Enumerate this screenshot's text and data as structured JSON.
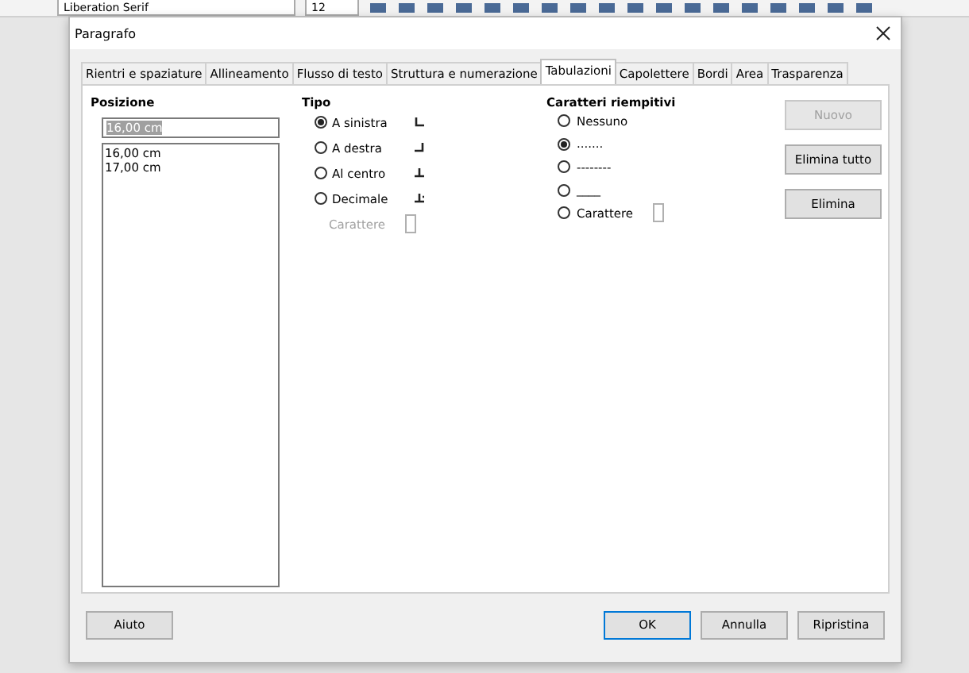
{
  "toolbar": {
    "font_name": "Liberation Serif",
    "font_size": "12"
  },
  "window": {
    "title": "Paragrafo"
  },
  "tabs": [
    {
      "label": "Rientri e spaziature",
      "selected": false
    },
    {
      "label": "Allineamento",
      "selected": false
    },
    {
      "label": "Flusso di testo",
      "selected": false
    },
    {
      "label": "Struttura e numerazione",
      "selected": false
    },
    {
      "label": "Tabulazioni",
      "selected": true
    },
    {
      "label": "Capolettere",
      "selected": false
    },
    {
      "label": "Bordi",
      "selected": false
    },
    {
      "label": "Area",
      "selected": false
    },
    {
      "label": "Trasparenza",
      "selected": false
    }
  ],
  "position": {
    "heading": "Posizione",
    "value": "16,00 cm",
    "items": [
      "16,00 cm",
      "17,00 cm"
    ]
  },
  "type": {
    "heading": "Tipo",
    "options": [
      {
        "label": "A sinistra",
        "kind": "left",
        "selected": true
      },
      {
        "label": "A destra",
        "kind": "right",
        "selected": false
      },
      {
        "label": "Al centro",
        "kind": "center",
        "selected": false
      },
      {
        "label": "Decimale",
        "kind": "decimal",
        "selected": false
      }
    ],
    "character_label": "Carattere",
    "character_disabled": true
  },
  "fill": {
    "heading": "Caratteri riempitivi",
    "options": [
      {
        "label": "Nessuno",
        "selected": false
      },
      {
        "label": ".......",
        "selected": true
      },
      {
        "label": "--------",
        "selected": false
      },
      {
        "label": "____",
        "selected": false
      },
      {
        "label": "Carattere",
        "selected": false
      }
    ]
  },
  "side_buttons": [
    {
      "label": "Nuovo",
      "disabled": true
    },
    {
      "label": "Elimina tutto",
      "disabled": false
    },
    {
      "label": "Elimina",
      "disabled": false
    }
  ],
  "help_button": "Aiuto",
  "buttons": [
    {
      "label": "OK",
      "default": true
    },
    {
      "label": "Annulla",
      "default": false
    },
    {
      "label": "Ripristina",
      "default": false
    }
  ]
}
